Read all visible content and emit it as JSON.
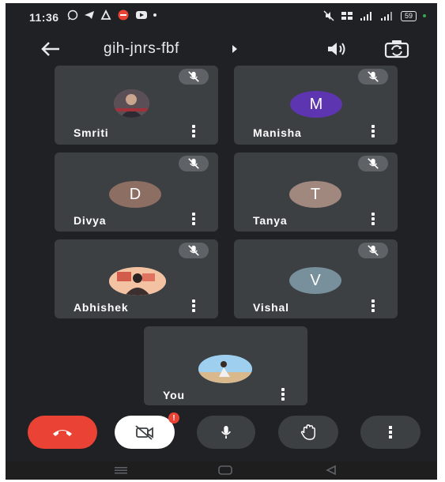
{
  "status": {
    "time": "11:36",
    "battery": "59"
  },
  "meeting": {
    "code": "gih-jnrs-fbf"
  },
  "participants": [
    {
      "name": "Smriti",
      "avatar": "photo",
      "muted": true
    },
    {
      "name": "Manisha",
      "initial": "M",
      "color": "#5e35b1",
      "muted": true
    },
    {
      "name": "Divya",
      "initial": "D",
      "color": "#8d6e63",
      "muted": true
    },
    {
      "name": "Tanya",
      "initial": "T",
      "color": "#a1887f",
      "muted": true
    },
    {
      "name": "Abhishek",
      "avatar": "photo",
      "muted": true
    },
    {
      "name": "Vishal",
      "initial": "V",
      "color": "#78909c",
      "muted": true
    },
    {
      "name": "You",
      "avatar": "photo"
    }
  ],
  "controls": {
    "end_call_color": "#ea4335",
    "camera_badge": "!",
    "items": [
      "end-call",
      "camera-off",
      "microphone",
      "raise-hand",
      "more-options"
    ]
  },
  "colors": {
    "background": "#202124",
    "tile": "#3c4043",
    "accent_red": "#ea4335"
  }
}
